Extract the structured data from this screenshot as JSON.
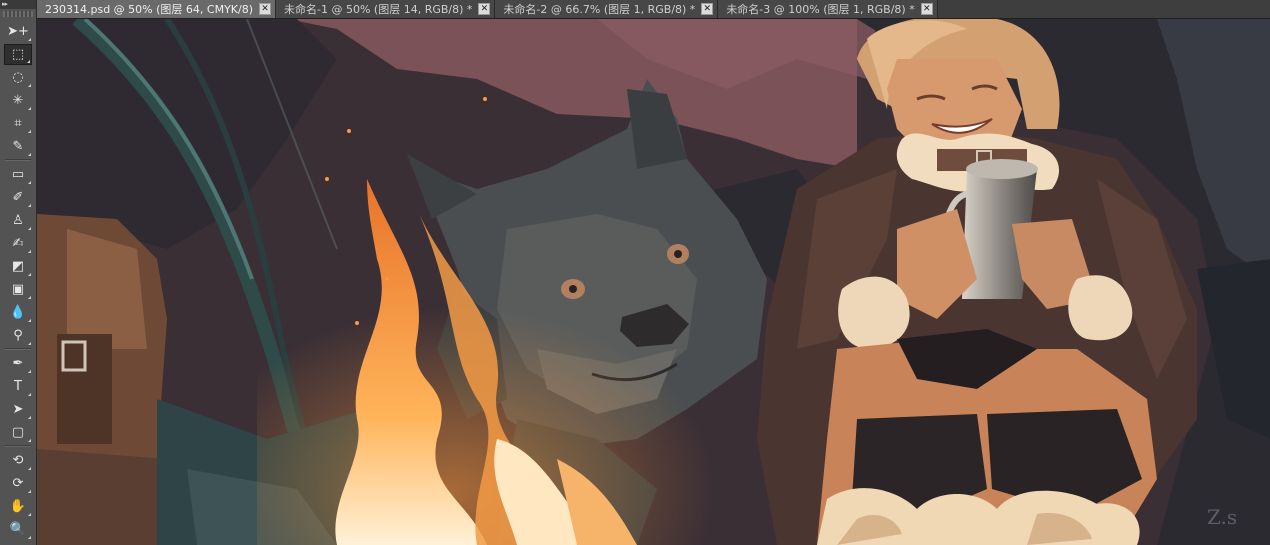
{
  "toolbox": {
    "grip_label": "▸▸",
    "tools": [
      {
        "name": "move-tool",
        "glyph": "➤+"
      },
      {
        "name": "marquee-tool",
        "glyph": "⬚"
      },
      {
        "name": "lasso-tool",
        "glyph": "◌"
      },
      {
        "name": "quick-select-tool",
        "glyph": "✳"
      },
      {
        "name": "crop-tool",
        "glyph": "⌗"
      },
      {
        "name": "eyedropper-tool",
        "glyph": "✎"
      },
      {
        "name": "healing-brush-tool",
        "glyph": "▭"
      },
      {
        "name": "brush-tool",
        "glyph": "✐"
      },
      {
        "name": "clone-stamp-tool",
        "glyph": "♙"
      },
      {
        "name": "history-brush-tool",
        "glyph": "✍"
      },
      {
        "name": "eraser-tool",
        "glyph": "◩"
      },
      {
        "name": "gradient-tool",
        "glyph": "▣"
      },
      {
        "name": "blur-tool",
        "glyph": "💧"
      },
      {
        "name": "dodge-tool",
        "glyph": "⚲"
      },
      {
        "name": "pen-tool",
        "glyph": "✒"
      },
      {
        "name": "type-tool",
        "glyph": "T"
      },
      {
        "name": "path-select-tool",
        "glyph": "➤"
      },
      {
        "name": "shape-tool",
        "glyph": "▢"
      },
      {
        "name": "3d-rotate-tool",
        "glyph": "⟲"
      },
      {
        "name": "3d-orbit-tool",
        "glyph": "⟳"
      },
      {
        "name": "hand-tool",
        "glyph": "✋"
      },
      {
        "name": "zoom-tool",
        "glyph": "🔍"
      }
    ]
  },
  "tabs": [
    {
      "label": "230314.psd @ 50% (图层 64, CMYK/8)",
      "active": true
    },
    {
      "label": "未命名-1 @ 50% (图层 14, RGB/8) *",
      "active": false
    },
    {
      "label": "未命名-2 @ 66.7% (图层 1, RGB/8) *",
      "active": false
    },
    {
      "label": "未命名-3 @ 100% (图层 1, RGB/8) *",
      "active": false
    }
  ],
  "tab_close_glyph": "✕",
  "canvas": {
    "signature": "Z.s"
  },
  "colors": {
    "ui_dark": "#535353",
    "tab_active": "#6a6a6a",
    "fire": "#f2a24a",
    "sky": "#7a5258"
  }
}
